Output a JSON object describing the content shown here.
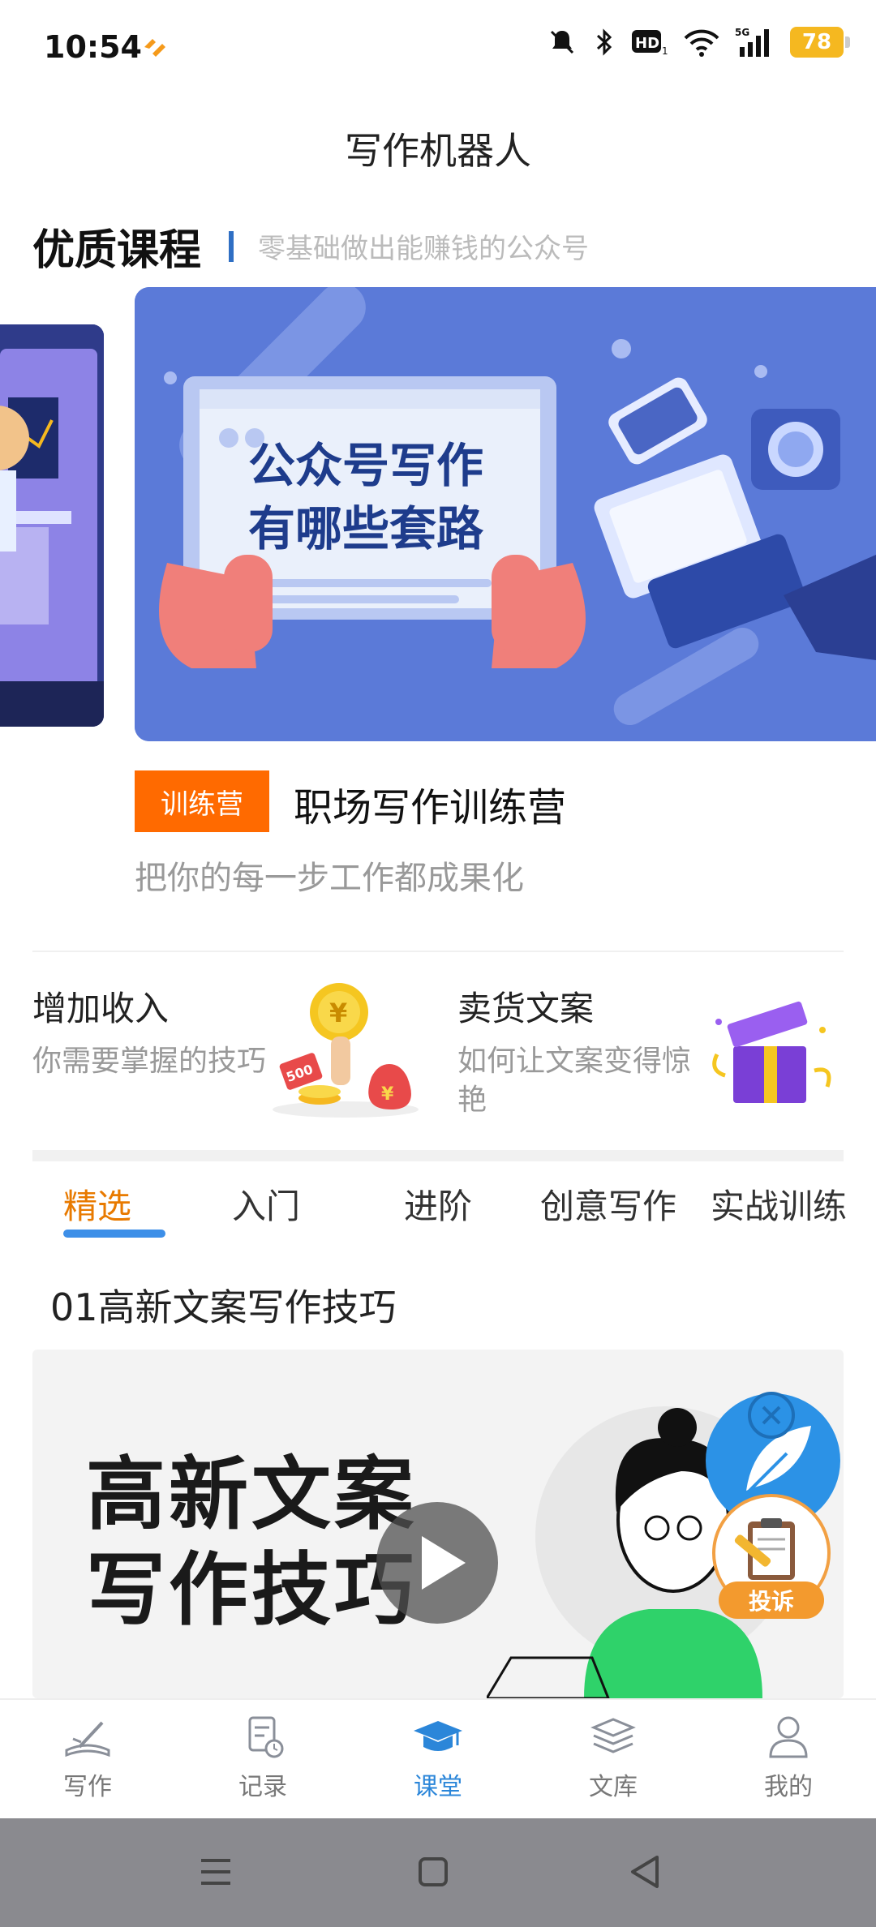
{
  "status_bar": {
    "time": "10:54",
    "network": "5G",
    "battery": "78",
    "icons": [
      "mute-icon",
      "bluetooth-icon",
      "hd-icon",
      "wifi-icon",
      "signal-icon",
      "battery-icon"
    ]
  },
  "app": {
    "title": "写作机器人"
  },
  "section": {
    "title": "优质课程",
    "subtitle": "零基础做出能赚钱的公众号"
  },
  "carousel": {
    "banner_text_line1": "公众号写作",
    "banner_text_line2": "有哪些套路",
    "tag": "训练营",
    "title": "职场写作训练营",
    "desc": "把你的每一步工作都成果化"
  },
  "promos": [
    {
      "title": "增加收入",
      "sub": "你需要掌握的技巧",
      "badge": "500"
    },
    {
      "title": "卖货文案",
      "sub": "如何让文案变得惊艳"
    }
  ],
  "tabs": [
    "精选",
    "入门",
    "进阶",
    "创意写作",
    "实战训练"
  ],
  "course": {
    "title": "01高新文案写作技巧",
    "thumb_line1": "高新文案",
    "thumb_line2": "写作技巧"
  },
  "fab": {
    "report_label": "投诉"
  },
  "bottom_nav": [
    {
      "label": "写作",
      "icon": "write-icon"
    },
    {
      "label": "记录",
      "icon": "record-icon"
    },
    {
      "label": "课堂",
      "icon": "graduation-cap-icon"
    },
    {
      "label": "文库",
      "icon": "library-layers-icon"
    },
    {
      "label": "我的",
      "icon": "profile-icon"
    }
  ],
  "colors": {
    "accent": "#2b86d9",
    "tab_active": "#e87a00",
    "tag": "#ff6a00",
    "battery": "#f5b820"
  }
}
